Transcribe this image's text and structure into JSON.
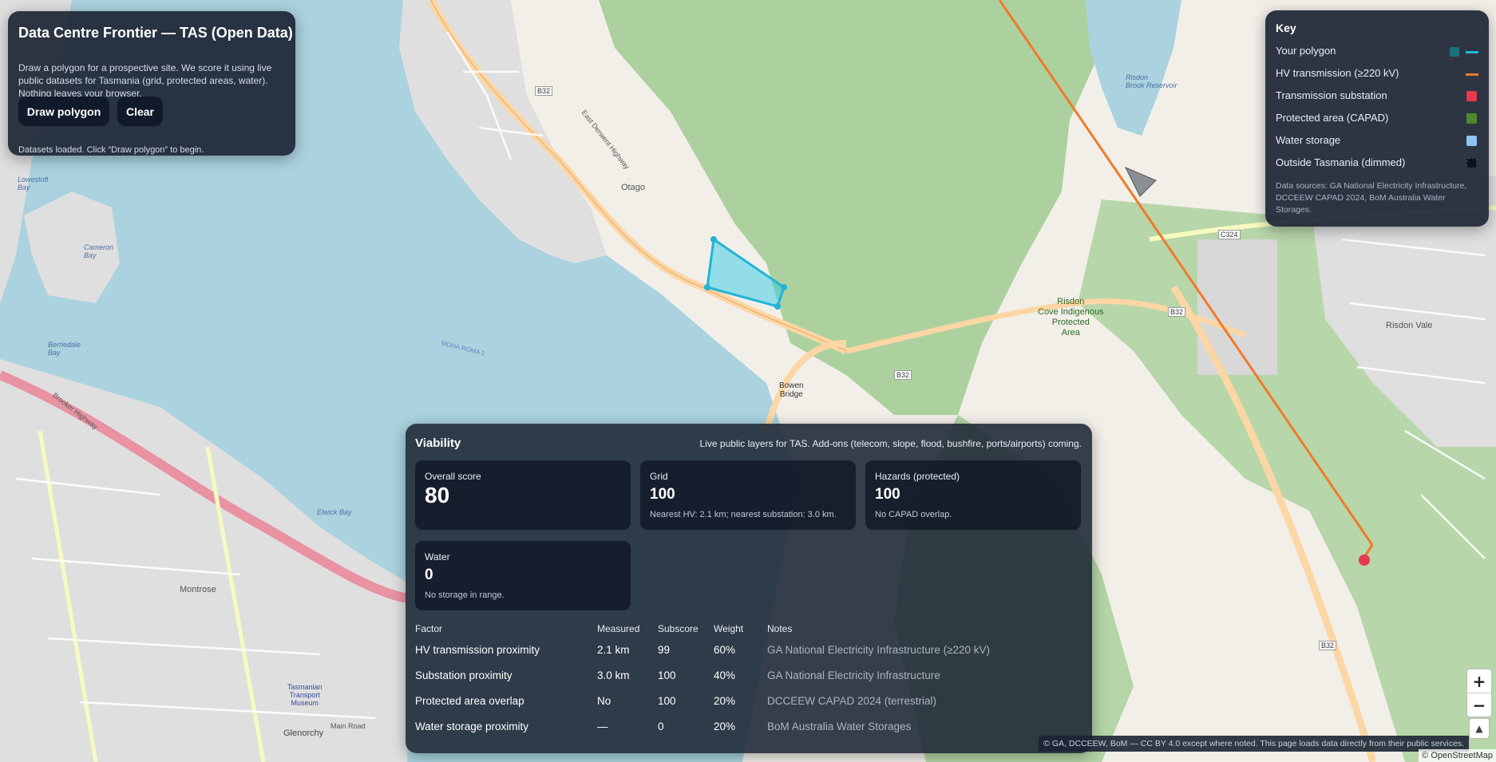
{
  "app": {
    "title": "Data Centre Frontier — TAS (Open Data)",
    "description": "Draw a polygon for a prospective site. We score it using live public datasets for Tasmania (grid, protected areas, water). Nothing leaves your browser.",
    "draw_button": "Draw polygon",
    "clear_button": "Clear",
    "status": "Datasets loaded. Click “Draw polygon” to begin."
  },
  "key": {
    "title": "Key",
    "items": [
      {
        "label": "Your polygon",
        "icon": "polygon-swatch-icon",
        "color": "#1fa5c4"
      },
      {
        "label": "HV transmission (≥220 kV)",
        "icon": "line-swatch-icon",
        "color": "#f07a2b"
      },
      {
        "label": "Transmission substation",
        "icon": "square-swatch-icon",
        "color": "#e8394f"
      },
      {
        "label": "Protected area (CAPAD)",
        "icon": "square-swatch-icon",
        "color": "#4d8a2a"
      },
      {
        "label": "Water storage",
        "icon": "square-swatch-icon",
        "color": "#8fc4f2"
      },
      {
        "label": "Outside Tasmania (dimmed)",
        "icon": "square-swatch-icon",
        "color": "#0b1320"
      }
    ],
    "sources": "Data sources: GA National Electricity Infrastructure, DCCEEW CAPAD 2024, BoM Australia Water Storages."
  },
  "viability": {
    "title": "Viability",
    "subtitle": "Live public layers for TAS. Add-ons (telecom, slope, flood, bushfire, ports/airports) coming.",
    "cards": {
      "overall": {
        "label": "Overall score",
        "value": "80"
      },
      "grid": {
        "label": "Grid",
        "value": "100",
        "note": "Nearest HV: 2.1 km; nearest substation: 3.0 km."
      },
      "hazards": {
        "label": "Hazards (protected)",
        "value": "100",
        "note": "No CAPAD overlap."
      },
      "water": {
        "label": "Water",
        "value": "0",
        "note": "No storage in range."
      }
    },
    "table": {
      "headers": {
        "factor": "Factor",
        "measured": "Measured",
        "subscore": "Subscore",
        "weight": "Weight",
        "notes": "Notes"
      },
      "rows": [
        {
          "factor": "HV transmission proximity",
          "measured": "2.1 km",
          "subscore": "99",
          "weight": "60%",
          "notes": "GA National Electricity Infrastructure (≥220 kV)"
        },
        {
          "factor": "Substation proximity",
          "measured": "3.0 km",
          "subscore": "100",
          "weight": "40%",
          "notes": "GA National Electricity Infrastructure"
        },
        {
          "factor": "Protected area overlap",
          "measured": "No",
          "subscore": "100",
          "weight": "20%",
          "notes": "DCCEEW CAPAD 2024 (terrestrial)"
        },
        {
          "factor": "Water storage proximity",
          "measured": "—",
          "subscore": "0",
          "weight": "20%",
          "notes": "BoM Australia Water Storages"
        }
      ]
    }
  },
  "map": {
    "labels": {
      "otago": "Otago",
      "bowen_bridge": "Bowen\nBridge",
      "risdon_cove": "Risdon\nCove Indigenous\nProtected\nArea",
      "risdon_vale": "Risdon Vale",
      "montrose": "Montrose",
      "glenorchy": "Glenorchy",
      "tasmanian_transport_museum": "Tasmanian\nTransport\nMuseum",
      "elwick_bay": "Elwick Bay",
      "lowestoft_bay": "Lowestoft\nBay",
      "cameron_bay": "Cameron\nBay",
      "berriedale_bay": "Berriedale\nBay",
      "b32_1": "B32",
      "b32_2": "B32",
      "b32_3": "B32",
      "b32_4": "B32",
      "c324": "C324",
      "east_derwent_highway": "East Derwent Highway",
      "brooker_highway": "Brooker Highway",
      "main_road": "Main Road",
      "risdon_brook_reservoir": "Risdon\nBrook Reservoir",
      "mona_roma": "MONA ROMA 1"
    },
    "zoom_in": "+",
    "zoom_out": "−",
    "compass": "▲",
    "attribution": "© GA, DCCEEW, BoM — CC BY 4.0 except where noted. This page loads data directly from their public services.",
    "osm_credit": "© OpenStreetMap"
  }
}
